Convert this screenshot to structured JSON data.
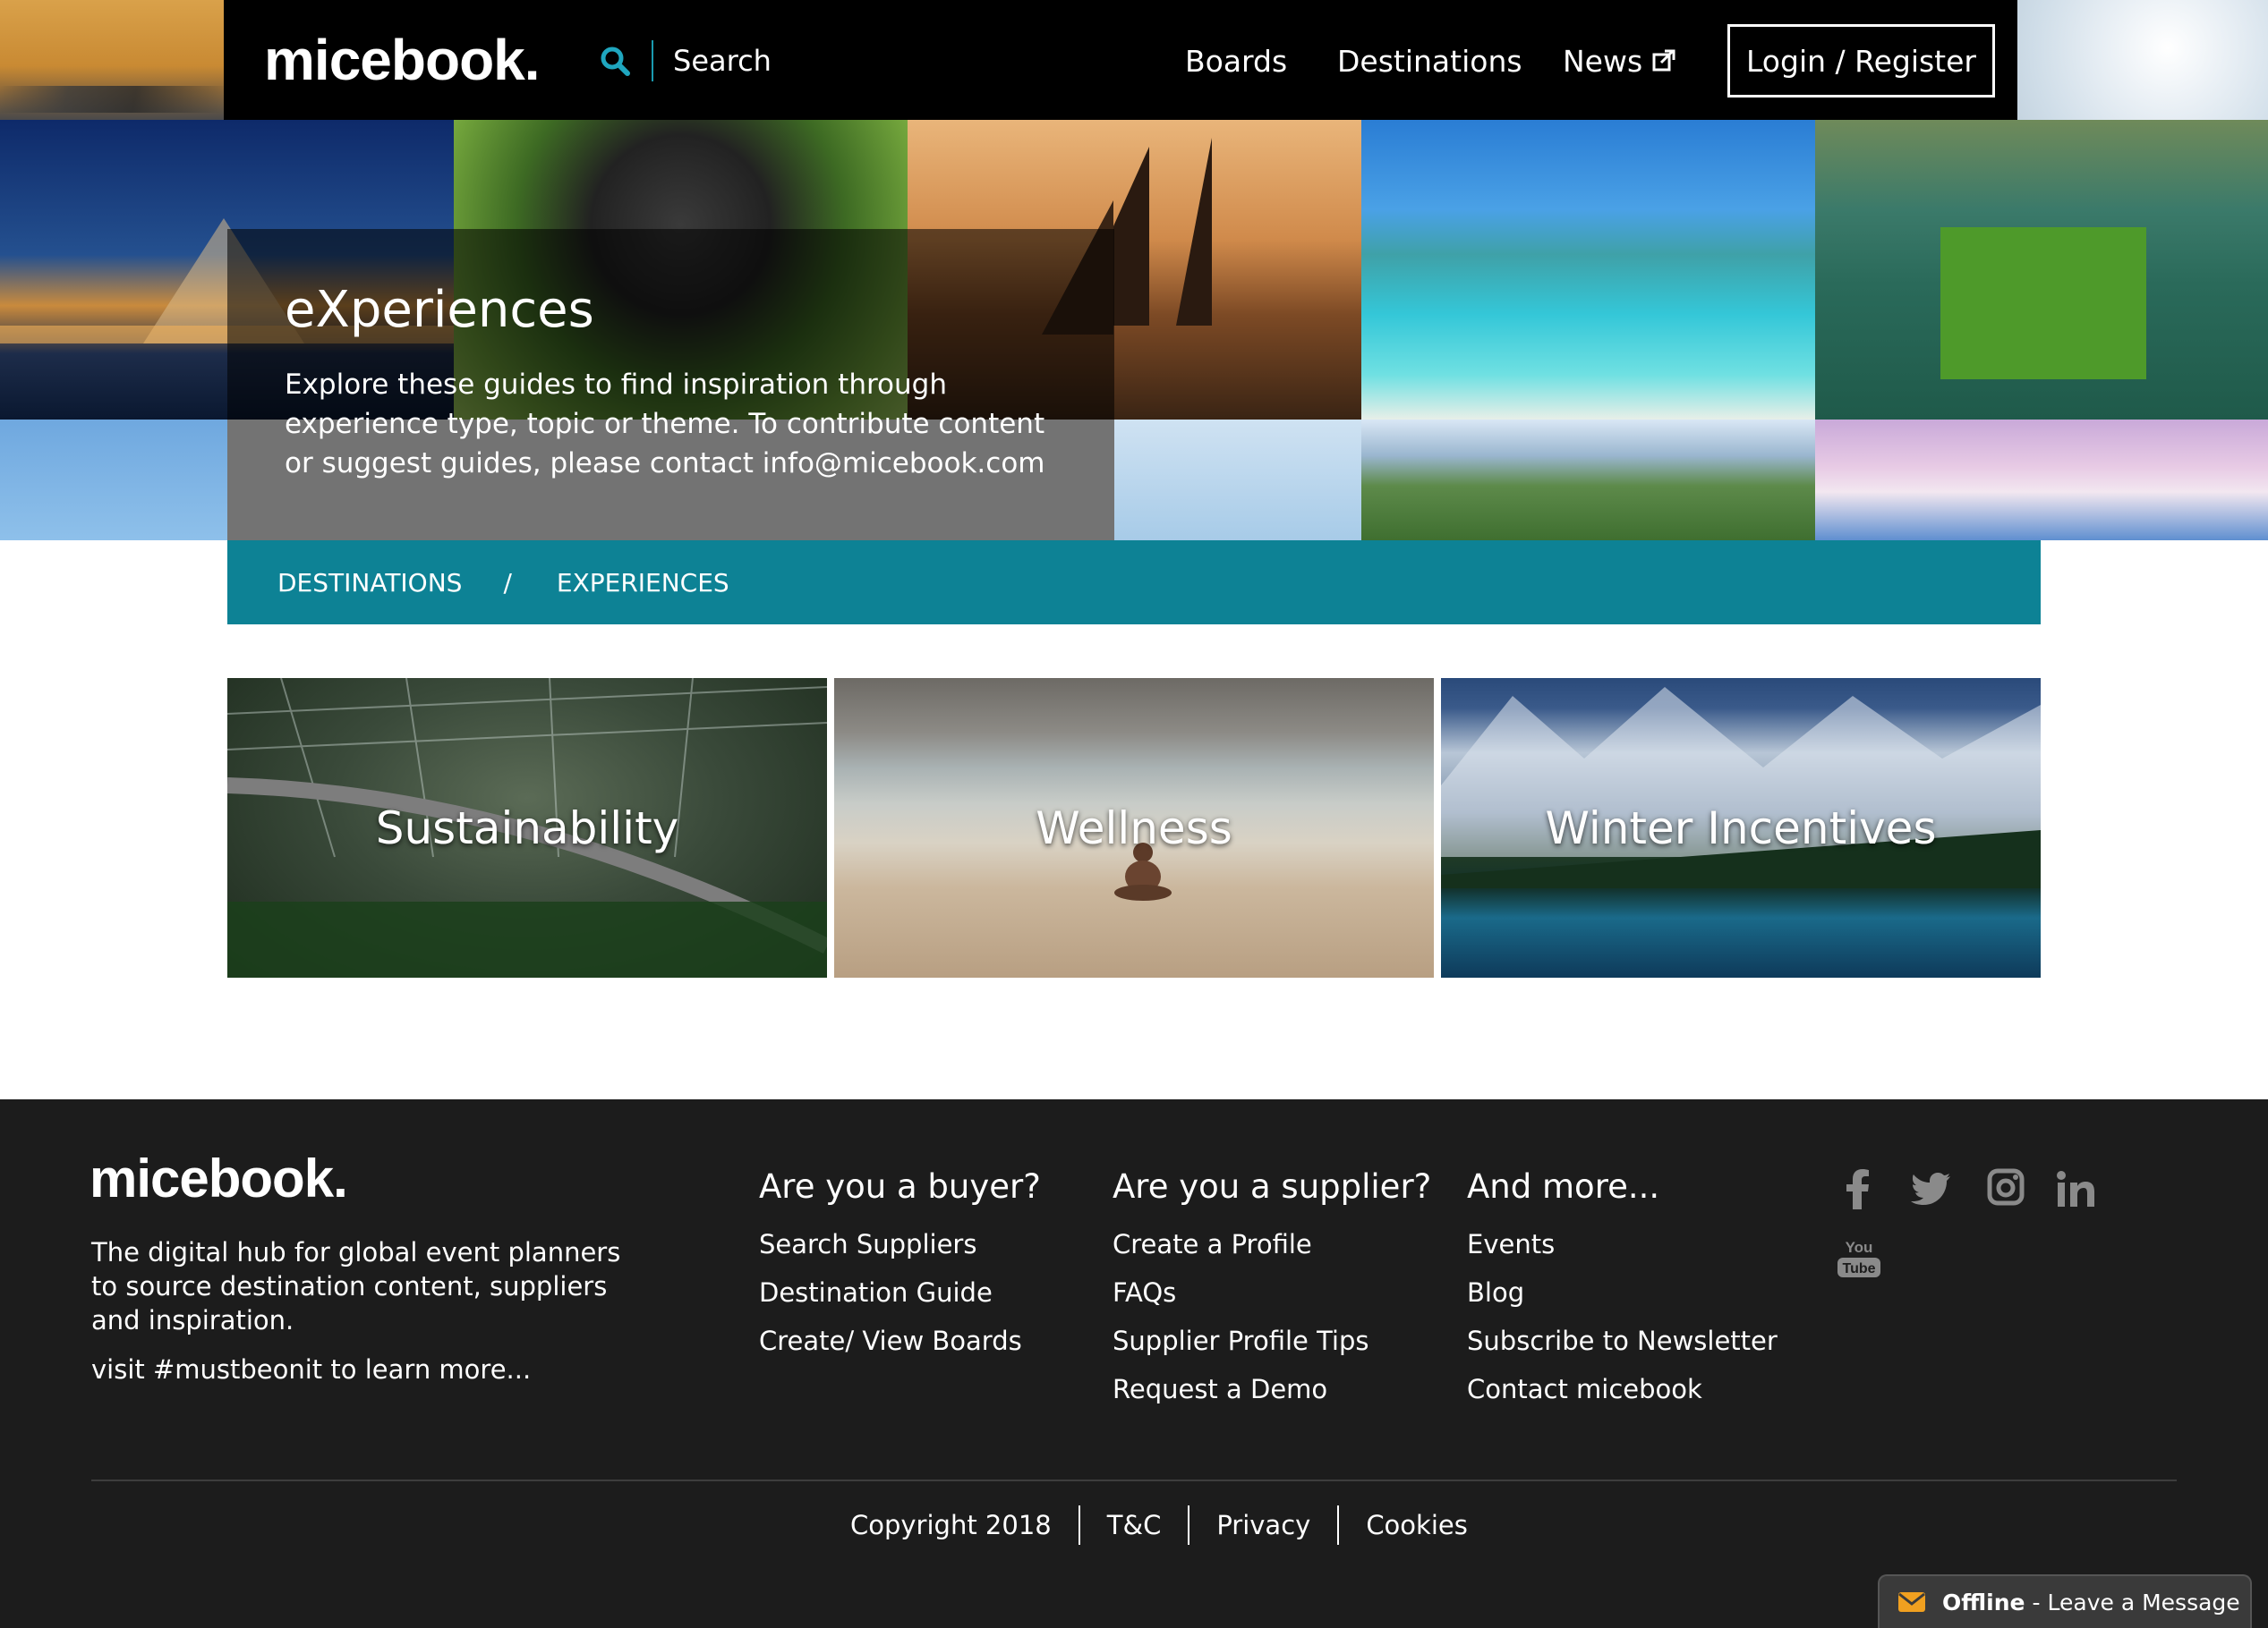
{
  "header": {
    "logo": "micebook.",
    "search_placeholder": "Search",
    "nav": {
      "boards": "Boards",
      "destinations": "Destinations",
      "news": "News"
    },
    "login_label": "Login / Register"
  },
  "hero": {
    "title": "eXperiences",
    "description": "Explore these guides to find inspiration through experience type, topic or theme. To contribute content or suggest guides, please contact info@micebook.com"
  },
  "breadcrumb": {
    "items": [
      "DESTINATIONS",
      "EXPERIENCES"
    ],
    "separator": "/"
  },
  "cards": [
    {
      "label": "Sustainability"
    },
    {
      "label": "Wellness"
    },
    {
      "label": "Winter Incentives"
    }
  ],
  "footer": {
    "logo": "micebook.",
    "description": "The digital hub for global event planners to source destination content, suppliers and inspiration.",
    "visit": "visit #mustbeonit to learn more...",
    "columns": [
      {
        "heading": "Are you a buyer?",
        "links": [
          "Search Suppliers",
          "Destination Guide",
          "Create/ View Boards"
        ]
      },
      {
        "heading": "Are you a supplier?",
        "links": [
          "Create a Profile",
          "FAQs",
          "Supplier Profile Tips",
          "Request a Demo"
        ]
      },
      {
        "heading": "And more...",
        "links": [
          "Events",
          "Blog",
          "Subscribe to Newsletter",
          "Contact micebook"
        ]
      }
    ],
    "social_icons": [
      "facebook-icon",
      "twitter-icon",
      "instagram-icon",
      "linkedin-icon",
      "youtube-icon"
    ],
    "youtube_text": [
      "You",
      "Tube"
    ],
    "legal": [
      "Copyright 2018",
      "T&C",
      "Privacy",
      "Cookies"
    ]
  },
  "chat": {
    "status": "Offline",
    "separator": "-",
    "message": "Leave a Message"
  },
  "colors": {
    "accent_teal": "#0d8295",
    "search_icon": "#1fa6bf",
    "header_bg": "#000000",
    "footer_bg": "#1c1c1c",
    "chat_icon": "#f0a020"
  }
}
